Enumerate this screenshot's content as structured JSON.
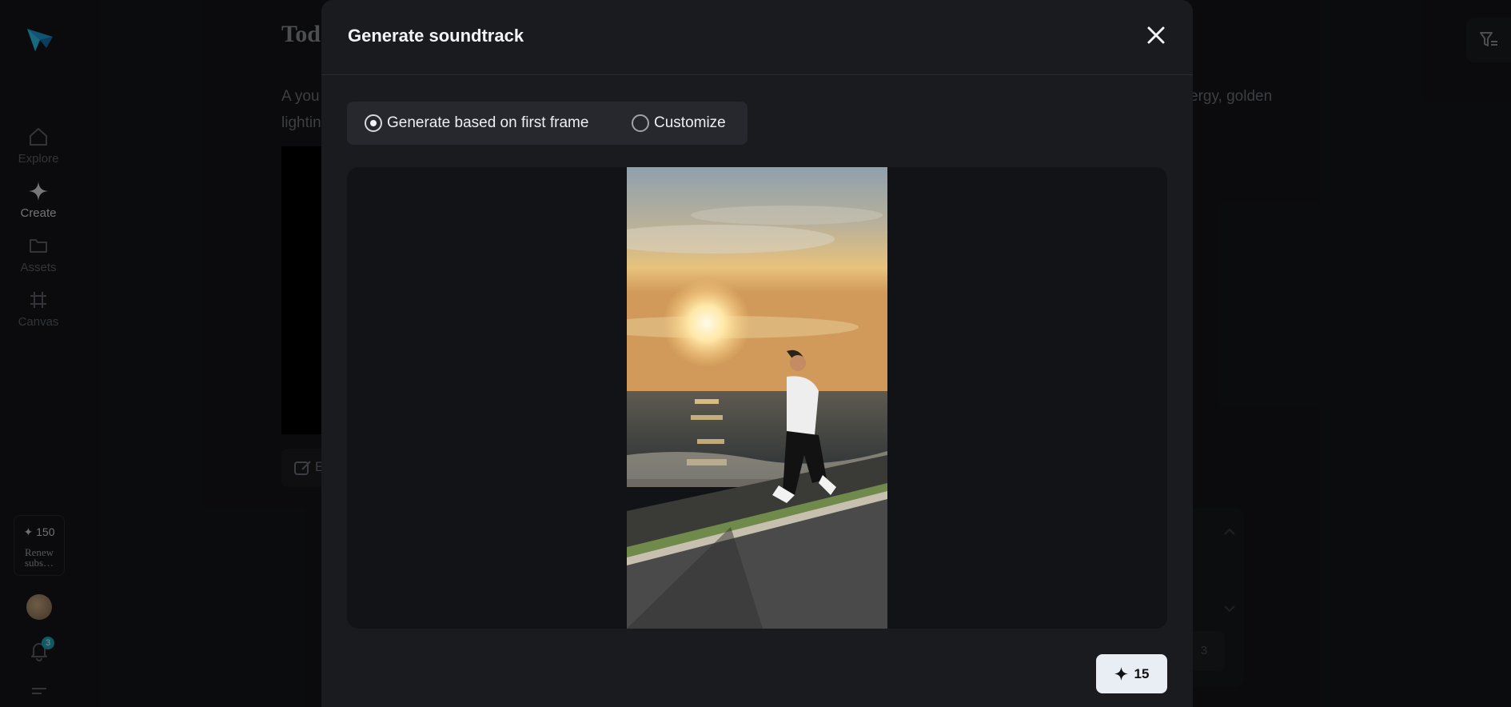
{
  "sidebar": {
    "items": [
      {
        "label": "Explore",
        "icon": "home-icon"
      },
      {
        "label": "Create",
        "icon": "sparkle-icon"
      },
      {
        "label": "Assets",
        "icon": "folder-icon"
      },
      {
        "label": "Canvas",
        "icon": "frame-icon"
      }
    ],
    "credits": {
      "amount": "✦ 150",
      "renew": "Renew subs…"
    },
    "notifications_count": "3"
  },
  "background": {
    "title": "Tod",
    "text_left": "A you",
    "text_left_line2": "lightin",
    "text_right": "ergy, golden",
    "edit_label": "E",
    "panel_tile": "3"
  },
  "modal": {
    "title": "Generate soundtrack",
    "modes": [
      {
        "label": "Generate based on first frame",
        "selected": true
      },
      {
        "label": "Customize",
        "selected": false
      }
    ],
    "generate_cost": "15"
  },
  "colors": {
    "accent_badge": "#1aa6b7",
    "primary_button": "#e9eef4"
  }
}
